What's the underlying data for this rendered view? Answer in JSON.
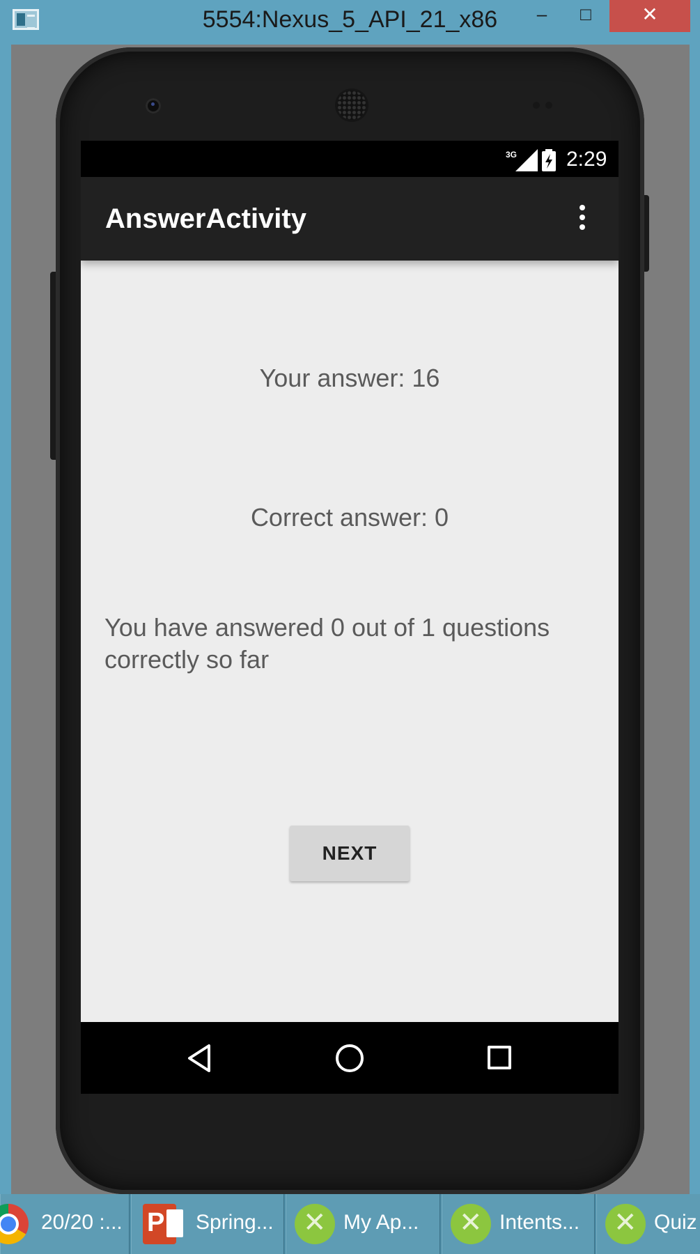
{
  "window": {
    "title": "5554:Nexus_5_API_21_x86",
    "minimize_glyph": "–",
    "maximize_glyph": "□",
    "close_glyph": "✕"
  },
  "status_bar": {
    "network_label": "3G",
    "time": "2:29"
  },
  "app_bar": {
    "title": "AnswerActivity",
    "overflow_icon": "more-vert-icon"
  },
  "content": {
    "your_answer": "Your answer: 16",
    "correct_answer": "Correct answer: 0",
    "progress_text": "You have answered 0 out of 1 questions correctly so far",
    "next_button_label": "NEXT"
  },
  "nav_bar": {
    "icons": [
      "back-icon",
      "home-icon",
      "recent-apps-icon"
    ]
  },
  "taskbar": {
    "items": [
      {
        "label": "20/20 :...",
        "icon": "chrome-icon"
      },
      {
        "label": "Spring...",
        "icon": "powerpoint-icon"
      },
      {
        "label": "My Ap...",
        "icon": "android-studio-icon"
      },
      {
        "label": "Intents...",
        "icon": "android-studio-icon"
      },
      {
        "label": "Quiz",
        "icon": "android-studio-icon"
      }
    ]
  },
  "colors": {
    "app_bar": "#212121",
    "screen_background": "#ededed",
    "button": "#d6d6d6",
    "window_frame": "#5fa3bf"
  }
}
